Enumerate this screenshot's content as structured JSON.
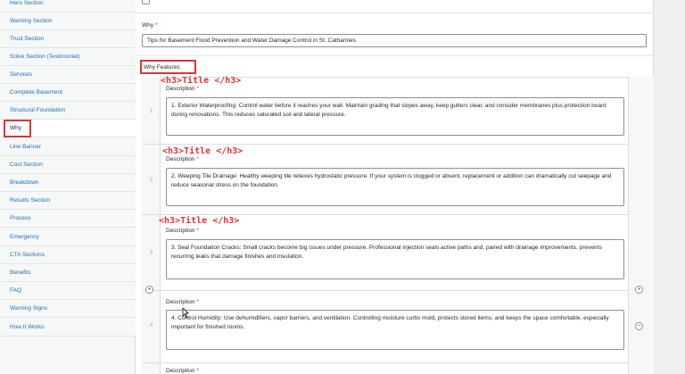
{
  "sidebar": {
    "items": [
      {
        "label": "Hero Section"
      },
      {
        "label": "Warning Section"
      },
      {
        "label": "Trust Section"
      },
      {
        "label": "Solve Section (Testimonial)"
      },
      {
        "label": "Services"
      },
      {
        "label": "Complete Basement"
      },
      {
        "label": "Structural Foundation"
      },
      {
        "label": "Why"
      },
      {
        "label": "Line Banner"
      },
      {
        "label": "Cost Section"
      },
      {
        "label": "Breakdown"
      },
      {
        "label": "Results Section"
      },
      {
        "label": "Process"
      },
      {
        "label": "Emergency"
      },
      {
        "label": "CTA Sections"
      },
      {
        "label": "Benefits"
      },
      {
        "label": "FAQ"
      },
      {
        "label": "Warning Signs"
      },
      {
        "label": "How It Works"
      }
    ],
    "active_item": "Why"
  },
  "fields": {
    "why_label": "Why",
    "required_marker": "*",
    "why_value": "Tips for Basement Flood Prevention and Water Damage Control in St. Catharines",
    "features_label": "Why Features"
  },
  "repeater": {
    "description_label": "Description",
    "annotation": "<h3>Title </h3>",
    "add_icon": "+",
    "remove_icon": "−",
    "collapse_icon": "•",
    "rows": [
      {
        "number": "1",
        "description": "1. Exterior Waterproofing: Control water before it reaches your wall. Maintain grading that slopes away, keep gutters clear, and consider membranes plus protection board during renovations. This reduces saturated soil and lateral pressure."
      },
      {
        "number": "2",
        "description": "2. Weeping Tile Drainage: Healthy weeping tile relieves hydrostatic pressure. If your system is clogged or absent, replacement or addition can dramatically cut seepage and reduce seasonal stress on the foundation."
      },
      {
        "number": "3",
        "description": "3. Seal Foundation Cracks: Small cracks become big issues under pressure. Professional injection seals active paths and, paired with drainage improvements, prevents recurring leaks that damage finishes and insulation."
      },
      {
        "number": "4",
        "description": "4. Control Humidity: Use dehumidifiers, vapor barriers, and ventilation. Controlling moisture curbs mold, protects stored items, and keeps the space comfortable, especially important for finished rooms."
      }
    ]
  }
}
